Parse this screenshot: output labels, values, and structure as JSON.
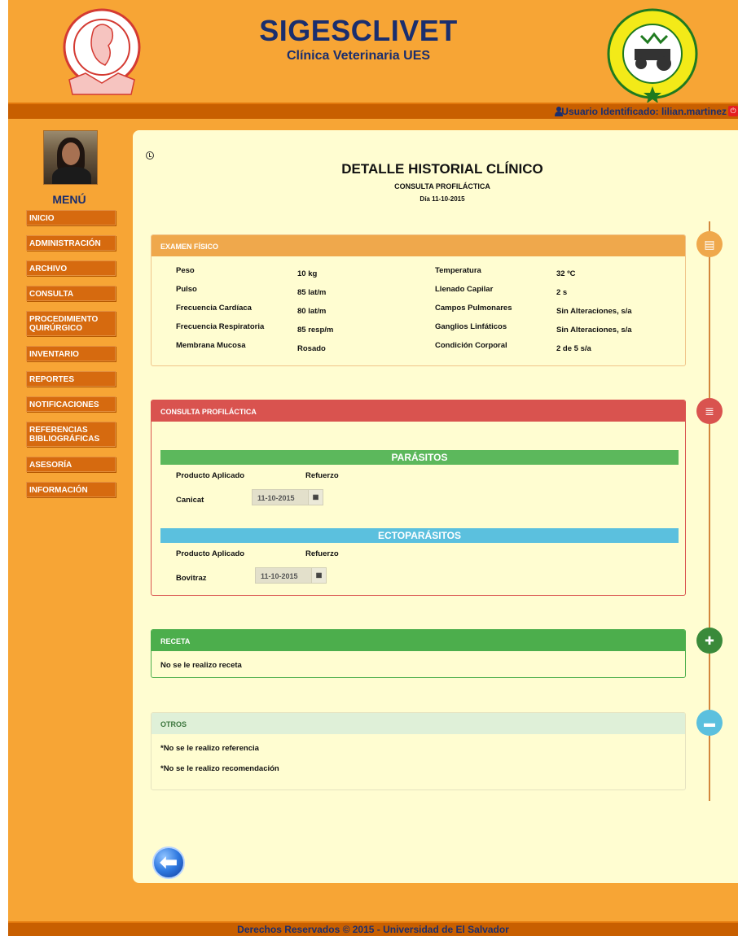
{
  "header": {
    "title": "SIGESCLIVET",
    "subtitle": "Clínica Veterinaria UES",
    "user_label": "Usuario Identificado: lilian.martinez"
  },
  "sidebar": {
    "menu_title": "MENÚ",
    "items": [
      {
        "label": "INICIO"
      },
      {
        "label": "ADMINISTRACIÓN"
      },
      {
        "label": "ARCHIVO"
      },
      {
        "label": "CONSULTA"
      },
      {
        "label": "PROCEDIMIENTO QUIRÚRGICO"
      },
      {
        "label": "INVENTARIO"
      },
      {
        "label": "REPORTES"
      },
      {
        "label": "NOTIFICACIONES"
      },
      {
        "label": "REFERENCIAS BIBLIOGRÁFICAS"
      },
      {
        "label": "ASESORÍA"
      },
      {
        "label": "INFORMACIÓN"
      }
    ]
  },
  "page": {
    "title": "DETALLE HISTORIAL CLÍNICO",
    "subtitle": "CONSULTA PROFILÁCTICA",
    "date": "Día 11-10-2015"
  },
  "exam": {
    "heading": "EXAMEN FÍSICO",
    "rows": [
      {
        "label1": "Peso",
        "value1": "10  kg",
        "label2": "Temperatura",
        "value2": "32  ºC"
      },
      {
        "label1": "Pulso",
        "value1": "85  lat/m",
        "label2": "Llenado Capilar",
        "value2": "2  s"
      },
      {
        "label1": "Frecuencia Cardíaca",
        "value1": "80  lat/m",
        "label2": "Campos Pulmonares",
        "value2": "Sin Alteraciones,  s/a"
      },
      {
        "label1": "Frecuencia Respiratoria",
        "value1": "85  resp/m",
        "label2": "Ganglios Linfáticos",
        "value2": "Sin Alteraciones,  s/a"
      },
      {
        "label1": "Membrana Mucosa",
        "value1": "Rosado",
        "label2": "Condición Corporal",
        "value2": "2 de 5  s/a"
      }
    ]
  },
  "prophylaxis": {
    "heading": "CONSULTA PROFILÁCTICA",
    "parasites": {
      "band": "PARÁSITOS",
      "product_label": "Producto Aplicado",
      "dose_label": "Refuerzo",
      "product": "Canicat",
      "date": "11-10-2015"
    },
    "ectoparasites": {
      "band": "ECTOPARÁSITOS",
      "product_label": "Producto Aplicado",
      "dose_label": "Refuerzo",
      "product": "Bovitraz",
      "date": "11-10-2015"
    }
  },
  "prescription": {
    "heading": "RECETA",
    "text": "No se le realizo receta"
  },
  "others": {
    "heading": "OTROS",
    "reference": "*No se le realizo referencia",
    "recommendation": "*No se le realizo recomendación"
  },
  "footer": {
    "text": "Derechos Reservados © 2015 - Universidad de El Salvador"
  },
  "colors": {
    "background": "#f7a535",
    "bar": "#c85f00",
    "content": "#fffdd1",
    "exam": "#efa84c",
    "prophylaxis": "#d9534f",
    "parasites": "#5cb85c",
    "ectoparasites": "#5bc0de",
    "prescription": "#4cae4c",
    "others": "#dff0d8"
  }
}
